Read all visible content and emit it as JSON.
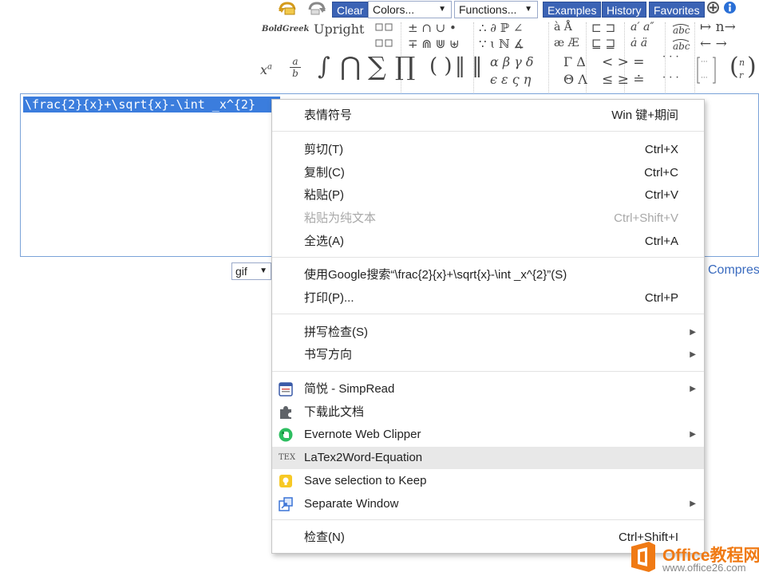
{
  "toolbar": {
    "clear_label": "Clear",
    "colors_label": "Colors...",
    "functions_label": "Functions...",
    "examples_label": "Examples",
    "history_label": "History",
    "favorites_label": "Favorites",
    "dropdown_arrow": "▼",
    "accent_color": "#3b63b5"
  },
  "palette": {
    "font_styles": {
      "boldgreek": "BoldGreek",
      "upright": "Upright"
    },
    "operators_row1": "± ∩ ∪ •",
    "operators_row2": "∓ ⋒ ⋓ ⊎",
    "misc_row1": "∴ ∂ ℙ ∠",
    "misc_row2": "∵ ɩ ℕ ∡",
    "accents_row1": "à Å",
    "accents_row2": "æ Æ",
    "subset_row1": "⊏ ⊐",
    "subset_row2": "⊑ ⊒",
    "prime_row1": "a′ a″",
    "prime_row2": "ȧ ä",
    "arrows_row1": "↦ n→",
    "arrows_row2": "← →",
    "power_base": "x",
    "power_exp": "a",
    "frac_num": "a",
    "frac_den": "b",
    "integral": "∫",
    "bigcap": "⋂",
    "sum": "∑",
    "prod": "∏",
    "brackets": "( )",
    "norms": "‖ ‖",
    "greek_row1": "α β γ δ",
    "greek_row2": "ϵ ε ς η",
    "biggreek_row1": "Γ Δ",
    "biggreek_row2": "Θ Λ",
    "relations_row1": "< > =",
    "relations_row2": "≤ ≥ ≐",
    "dots_row1": "· · ·",
    "dots_row2": "· · ·",
    "binom_top": "n",
    "binom_bottom": "r"
  },
  "editor": {
    "selected_text": "\\frac{2}{x}+\\sqrt{x}-\\int _x^{2}",
    "selection_color": "#3b7ddd"
  },
  "output": {
    "format_value": "gif",
    "compress_link": "Compres"
  },
  "context_menu": {
    "emoji": {
      "label": "表情符号",
      "shortcut": "Win 键+期间"
    },
    "cut": {
      "label": "剪切(T)",
      "shortcut": "Ctrl+X"
    },
    "copy": {
      "label": "复制(C)",
      "shortcut": "Ctrl+C"
    },
    "paste": {
      "label": "粘贴(P)",
      "shortcut": "Ctrl+V"
    },
    "paste_plain": {
      "label": "粘贴为纯文本",
      "shortcut": "Ctrl+Shift+V"
    },
    "select_all": {
      "label": "全选(A)",
      "shortcut": "Ctrl+A"
    },
    "google_search": {
      "label": "使用Google搜索“\\frac{2}{x}+\\sqrt{x}-\\int _x^{2}”(S)"
    },
    "print": {
      "label": "打印(P)...",
      "shortcut": "Ctrl+P"
    },
    "spellcheck": {
      "label": "拼写检查(S)"
    },
    "writing_direction": {
      "label": "书写方向"
    },
    "simpread": {
      "label": "简悦 - SimpRead"
    },
    "download_doc": {
      "label": "下载此文档"
    },
    "evernote": {
      "label": "Evernote Web Clipper"
    },
    "latex2word": {
      "label": "LaTex2Word-Equation",
      "icon_text": "TEX"
    },
    "keep": {
      "label": "Save selection to Keep"
    },
    "separate_window": {
      "label": "Separate Window"
    },
    "inspect": {
      "label": "检查(N)",
      "shortcut": "Ctrl+Shift+I"
    },
    "submenu_arrow": "▶"
  },
  "watermark": {
    "title": "Office教程网",
    "url": "www.office26.com",
    "color": "#f07a14"
  }
}
